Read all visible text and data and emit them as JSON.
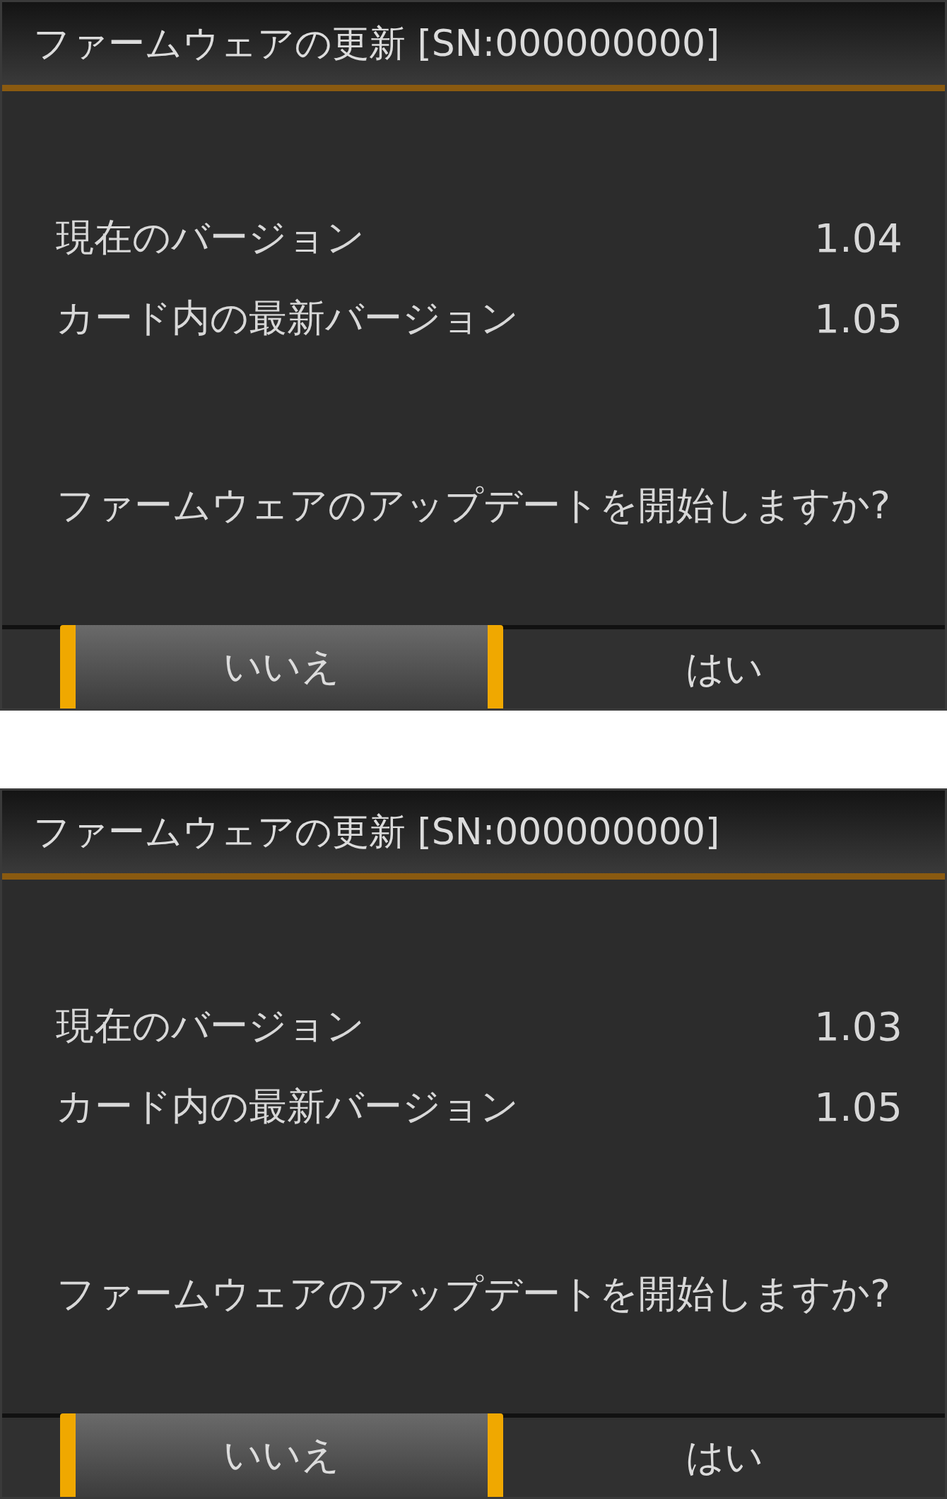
{
  "screens": [
    {
      "title": "ファームウェアの更新 [SN:000000000]",
      "rows": [
        {
          "label": "現在のバージョン",
          "value": "1.04"
        },
        {
          "label": "カード内の最新バージョン",
          "value": "1.05"
        }
      ],
      "question": "ファームウェアのアップデートを開始しますか?",
      "buttons": [
        {
          "label": "いいえ",
          "selected": true
        },
        {
          "label": "はい",
          "selected": false
        }
      ]
    },
    {
      "title": "ファームウェアの更新 [SN:000000000]",
      "rows": [
        {
          "label": "現在のバージョン",
          "value": "1.03"
        },
        {
          "label": "カード内の最新バージョン",
          "value": "1.05"
        }
      ],
      "question": "ファームウェアのアップデートを開始しますか?",
      "buttons": [
        {
          "label": "いいえ",
          "selected": true
        },
        {
          "label": "はい",
          "selected": false
        }
      ]
    }
  ]
}
